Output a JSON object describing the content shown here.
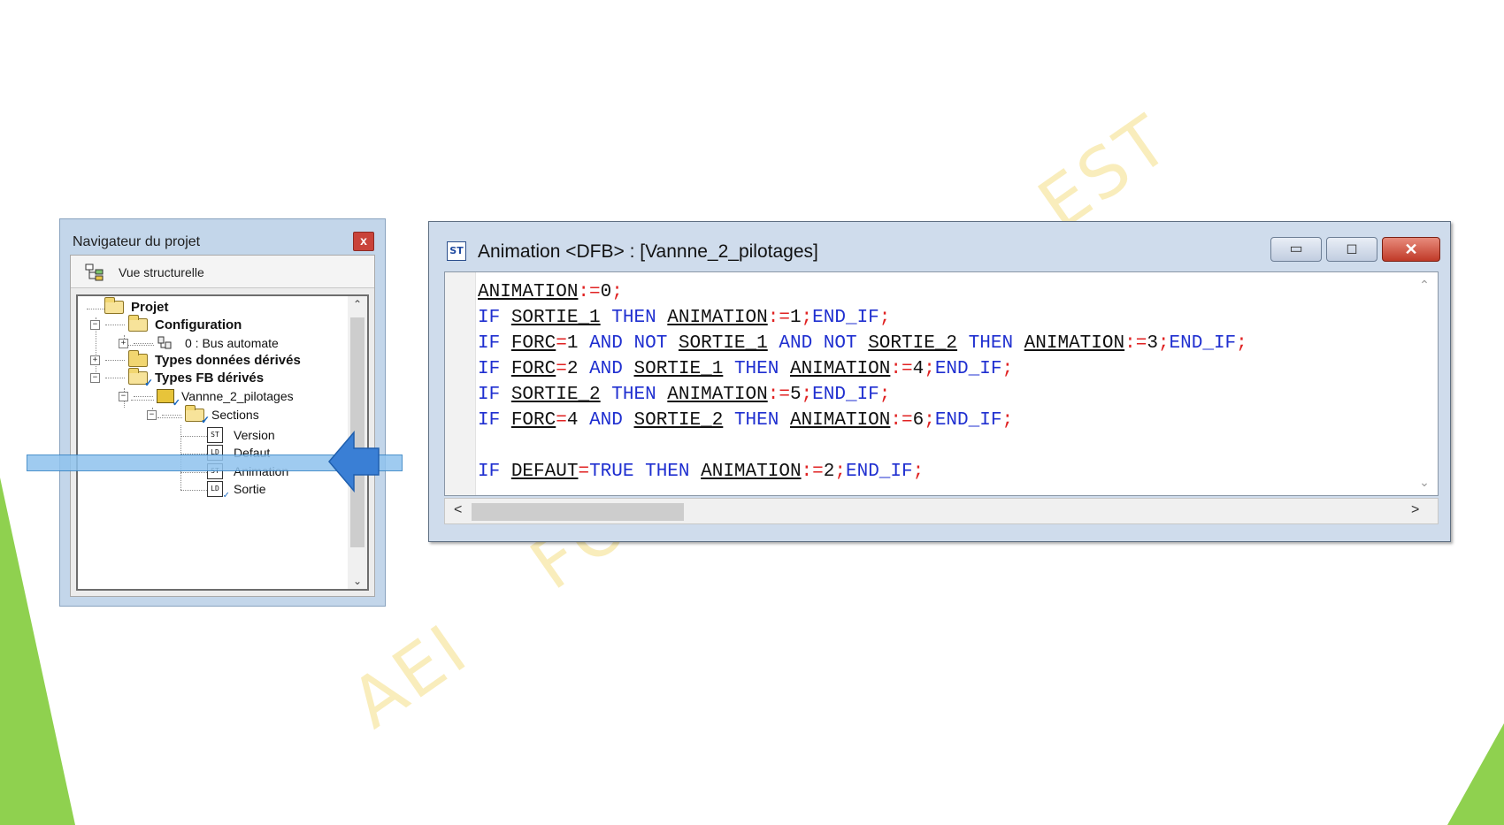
{
  "watermark": {
    "text_top": "EST",
    "text_mid": "FO",
    "text_bottom": "AEI"
  },
  "navigator": {
    "title": "Navigateur du projet",
    "close_label": "x",
    "view_label": "Vue structurelle",
    "tree": {
      "project": "Projet",
      "configuration": "Configuration",
      "bus": "0 : Bus automate",
      "derived_data_types": "Types données dérivés",
      "derived_fb_types": "Types FB dérivés",
      "fb_instance": "Vannne_2_pilotages",
      "sections": "Sections",
      "section_items": [
        {
          "label": "Version",
          "lang": "ST"
        },
        {
          "label": "Defaut",
          "lang": "LD"
        },
        {
          "label": "Animation",
          "lang": "ST"
        },
        {
          "label": "Sortie",
          "lang": "LD"
        }
      ],
      "expander_collapsed": "+",
      "expander_expanded": "−"
    },
    "selected_item": "Defaut"
  },
  "editor": {
    "icon_text": "ST",
    "title": "Animation <DFB> : [Vannne_2_pilotages]",
    "min_label": "▭",
    "max_label": "◻",
    "close_label": "✕",
    "code": [
      "ANIMATION:=0;",
      "IF SORTIE_1 THEN ANIMATION:=1;END_IF;",
      "IF FORC=1 AND NOT SORTIE_1 AND NOT SORTIE_2 THEN ANIMATION:=3;END_IF;",
      "IF FORC=2 AND SORTIE_1 THEN ANIMATION:=4;END_IF;",
      "IF SORTIE_2 THEN ANIMATION:=5;END_IF;",
      "IF FORC=4 AND SORTIE_2 THEN ANIMATION:=6;END_IF;",
      "",
      "IF DEFAUT=TRUE THEN ANIMATION:=2;END_IF;"
    ],
    "scroll_left": "<",
    "scroll_right": ">",
    "scroll_up": "^",
    "scroll_down": "v"
  },
  "colors": {
    "keyword": "#1f2fd0",
    "operator": "#e02222",
    "identifier": "#111111",
    "accent_green": "#8fd14f",
    "highlight": "#8fc3ee",
    "arrow_blue": "#3a7fd5"
  },
  "icons": [
    "folder-icon",
    "bus-icon",
    "fb-icon",
    "section-icon",
    "close-icon",
    "minimize-icon",
    "maximize-icon",
    "arrow-icon"
  ]
}
